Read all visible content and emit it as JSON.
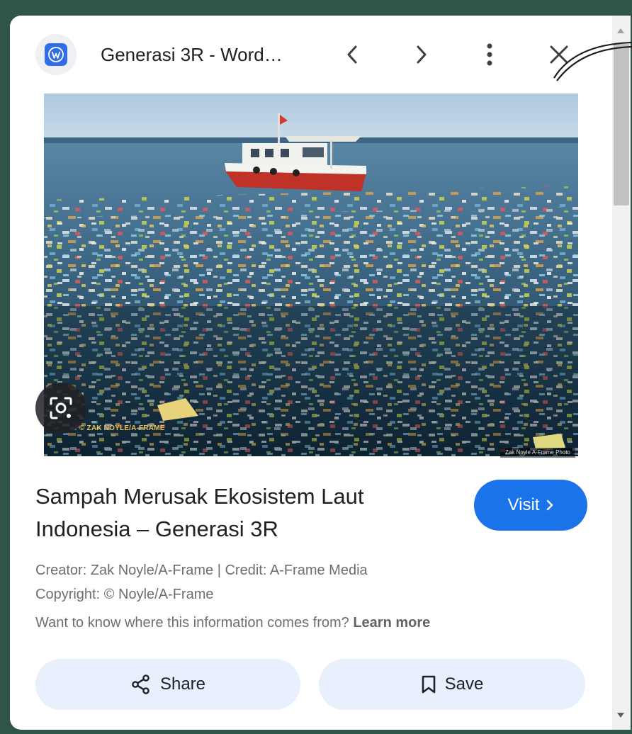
{
  "header": {
    "site_title": "Generasi 3R - Word…",
    "site_icon": "wordpress-icon",
    "back_icon": "chevron-left-icon",
    "forward_icon": "chevron-right-icon",
    "menu_icon": "more-vert-icon",
    "close_icon": "close-icon"
  },
  "image": {
    "watermark_left": "© ZAK NOYLE/A-FRAME",
    "watermark_right": "Zak Noyle A-Frame Photo",
    "lens_icon": "lens-search-icon"
  },
  "result": {
    "heading_line1": "Sampah Merusak Ekosistem Laut",
    "heading_line2": "Indonesia – Generasi 3R",
    "visit_label": "Visit",
    "creator_line": "Creator: Zak Noyle/A-Frame | Credit: A-Frame Media",
    "copyright_line": "Copyright: © Noyle/A-Frame",
    "info_question": "Want to know where this information comes from?",
    "learn_more": "Learn more"
  },
  "actions": {
    "share_label": "Share",
    "save_label": "Save"
  },
  "colors": {
    "accent": "#1a73e8",
    "button_bg": "#e8f0fe",
    "frame_bg": "#2f5448"
  }
}
